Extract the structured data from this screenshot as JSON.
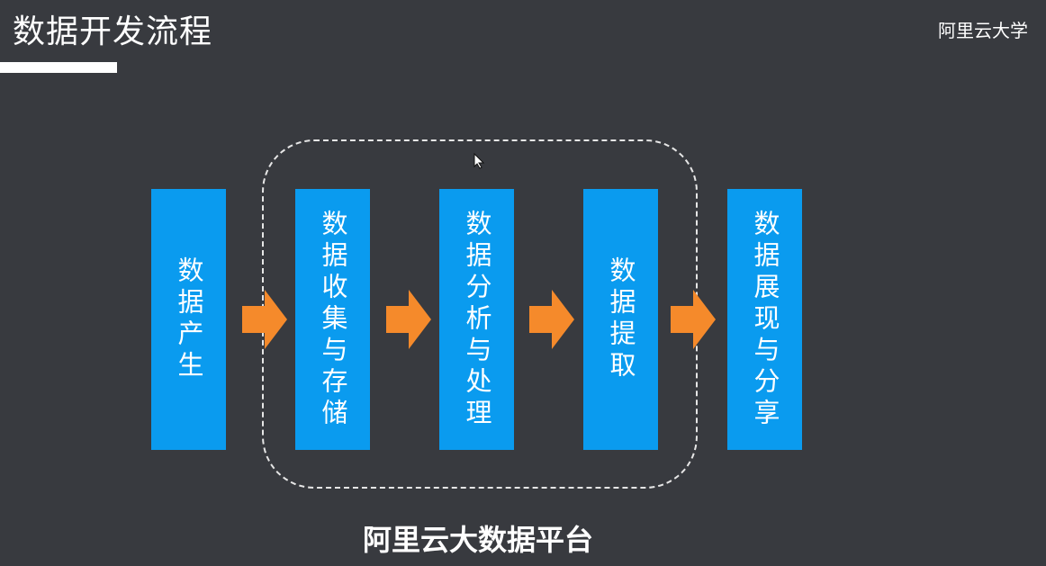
{
  "header": {
    "title": "数据开发流程",
    "brand": "阿里云大学"
  },
  "steps": [
    {
      "label": "数据产生"
    },
    {
      "label": "数据收集与存储"
    },
    {
      "label": "数据分析与处理"
    },
    {
      "label": "数据提取"
    },
    {
      "label": "数据展现与分享"
    }
  ],
  "platform": {
    "label": "阿里云大数据平台"
  },
  "icons": {
    "arrow": "arrow-right-icon",
    "cursor": "mouse-cursor-icon"
  },
  "colors": {
    "background": "#383a3f",
    "step": "#0a9bef",
    "arrow": "#f58a2b",
    "text": "#ffffff"
  }
}
